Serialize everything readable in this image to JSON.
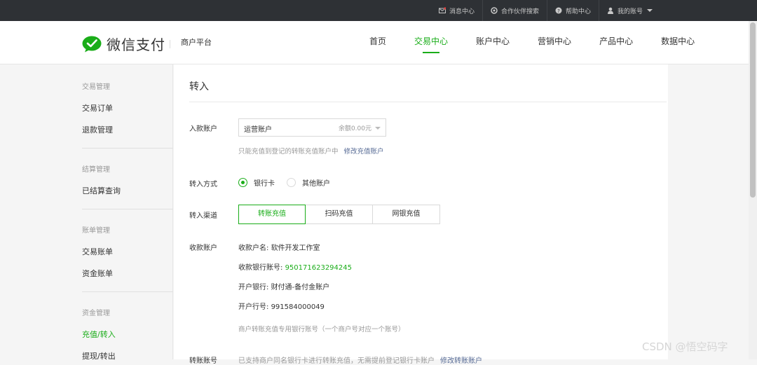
{
  "topbar": {
    "items": [
      {
        "label": "消息中心",
        "icon": "mail-icon"
      },
      {
        "label": "合作伙伴搜索",
        "icon": "gear-icon"
      },
      {
        "label": "帮助中心",
        "icon": "help-icon"
      },
      {
        "label": "我的账号",
        "icon": "user-icon"
      }
    ]
  },
  "header": {
    "logo_text": "微信支付",
    "platform": "商户平台",
    "nav": [
      "首页",
      "交易中心",
      "账户中心",
      "营销中心",
      "产品中心",
      "数据中心"
    ],
    "active_nav": "交易中心"
  },
  "sidebar": {
    "groups": [
      {
        "title": "交易管理",
        "items": [
          "交易订单",
          "退款管理"
        ]
      },
      {
        "title": "结算管理",
        "items": [
          "已结算查询"
        ]
      },
      {
        "title": "账单管理",
        "items": [
          "交易账单",
          "资金账单"
        ]
      },
      {
        "title": "资金管理",
        "items": [
          "充值/转入",
          "提现/转出"
        ]
      }
    ],
    "active_item": "充值/转入"
  },
  "main": {
    "title": "转入",
    "account_label": "入款账户",
    "account_value": "运营账户",
    "account_balance": "余额0.00元",
    "account_hint": "只能充值到登记的转账充值账户中",
    "account_hint_link": "修改充值账户",
    "method_label": "转入方式",
    "methods": [
      "银行卡",
      "其他账户"
    ],
    "channel_label": "转入渠道",
    "channels": [
      "转账充值",
      "扫码充值",
      "网银充值"
    ],
    "payee_label": "收款账户",
    "payee_name_label": "收款户名:",
    "payee_name": "软件开发工作室",
    "payee_account_label": "收款银行账号:",
    "payee_account": "950171623294245",
    "bank_label": "开户银行:",
    "bank": "财付通-备付金账户",
    "bank_no_label": "开户行号:",
    "bank_no": "991584000049",
    "payee_note": "商户转账充值专用银行账号（一个商户号对应一个账号）",
    "cut_label": "转账账号",
    "cut_text": "已支持商户同名银行卡进行转账充值，无需提前登记银行卡账户",
    "cut_link": "修改转账账户"
  },
  "watermark": "CSDN @悟空码字",
  "colors": {
    "accent": "#1aad19",
    "topbar": "#2e3135",
    "link": "#576b95"
  }
}
